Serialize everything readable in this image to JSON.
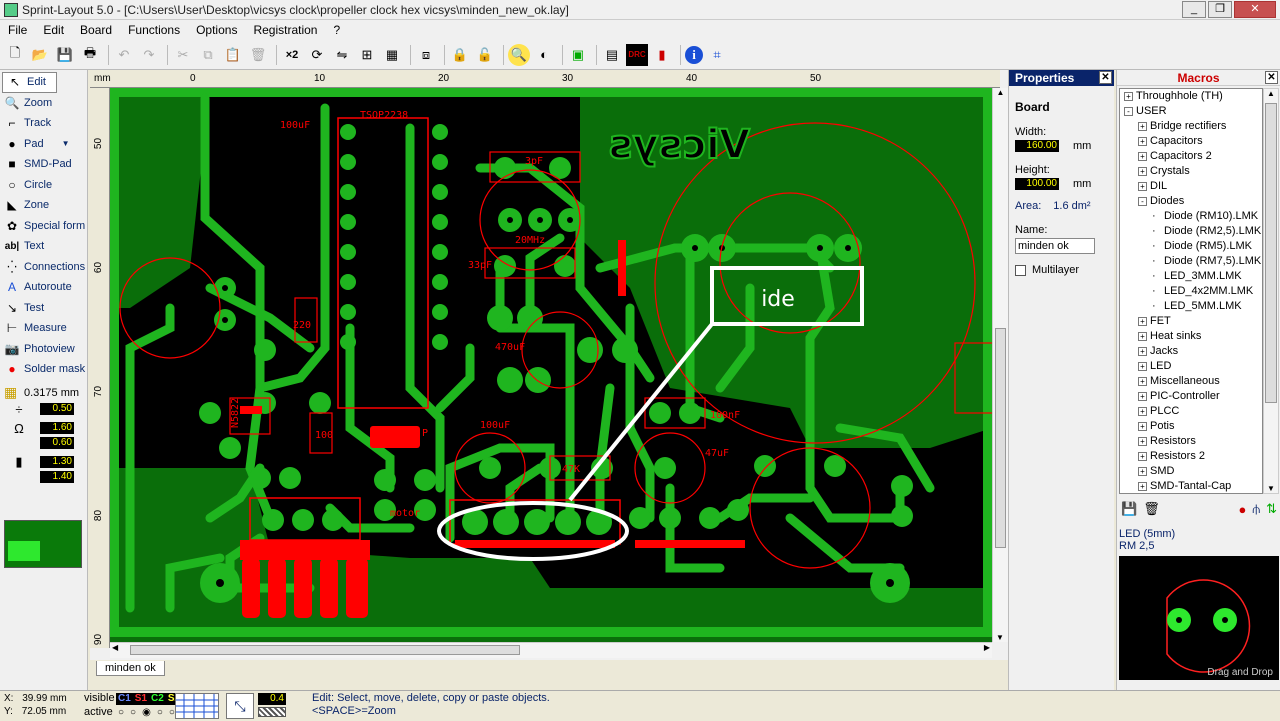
{
  "window": {
    "title": "Sprint-Layout 5.0 - [C:\\Users\\User\\Desktop\\vicsys clock\\propeller clock hex vicsys\\minden_new_ok.lay]",
    "min_icon": "minimize-icon",
    "max_icon": "maximize-icon",
    "close_icon": "close-icon"
  },
  "menu": [
    "File",
    "Edit",
    "Board",
    "Functions",
    "Options",
    "Registration",
    "?"
  ],
  "tools": [
    {
      "label": "Edit",
      "icon": "arrow-cursor-icon"
    },
    {
      "label": "Zoom",
      "icon": "magnifier-icon"
    },
    {
      "label": "Track",
      "icon": "track-icon"
    },
    {
      "label": "Pad",
      "icon": "pad-icon"
    },
    {
      "label": "SMD-Pad",
      "icon": "smd-pad-icon"
    },
    {
      "label": "Circle",
      "icon": "circle-icon"
    },
    {
      "label": "Zone",
      "icon": "zone-icon"
    },
    {
      "label": "Special form",
      "icon": "special-form-icon"
    },
    {
      "label": "Text",
      "icon": "text-icon"
    },
    {
      "label": "Connections",
      "icon": "connections-icon"
    },
    {
      "label": "Autoroute",
      "icon": "autoroute-icon"
    },
    {
      "label": "Test",
      "icon": "test-icon"
    },
    {
      "label": "Measure",
      "icon": "measure-icon"
    },
    {
      "label": "Photoview",
      "icon": "camera-icon"
    },
    {
      "label": "Solder mask",
      "icon": "solder-mask-icon"
    }
  ],
  "grid": {
    "value": "0.3175 mm"
  },
  "settings": {
    "track_width": "0.50",
    "pad_outer": "1.60",
    "pad_inner": "0.60",
    "smd_w": "1.30",
    "smd_h": "1.40"
  },
  "ruler": {
    "unit": "mm",
    "top_labels": [
      "0",
      "10",
      "20",
      "30",
      "40",
      "50"
    ],
    "left_labels": [
      "50",
      "60",
      "70",
      "80",
      "90"
    ]
  },
  "board": {
    "brand_text": "Vicsys",
    "annotation_text": "ide",
    "labels": [
      "100uF",
      "TSOP2238",
      "3pF",
      "20MHz",
      "33pF",
      "220",
      "100",
      "N5822",
      "470uF",
      "100uF",
      "47K",
      "100nF",
      "47uF",
      "motor",
      "P"
    ]
  },
  "tab": {
    "label": "minden ok"
  },
  "properties": {
    "title": "Properties",
    "section": "Board",
    "width_label": "Width:",
    "width_value": "160.00",
    "height_label": "Height:",
    "height_value": "100.00",
    "unit": "mm",
    "area_label": "Area:",
    "area_value": "1.6 dm²",
    "name_label": "Name:",
    "name_value": "minden ok",
    "multilayer_label": "Multilayer"
  },
  "macros": {
    "title": "Macros",
    "tree": [
      {
        "label": "Throughhole (TH)",
        "level": 0,
        "pm": "+"
      },
      {
        "label": "USER",
        "level": 0,
        "pm": "-"
      },
      {
        "label": "Bridge rectifiers",
        "level": 1,
        "pm": "+"
      },
      {
        "label": "Capacitors",
        "level": 1,
        "pm": "+"
      },
      {
        "label": "Capacitors 2",
        "level": 1,
        "pm": "+"
      },
      {
        "label": "Crystals",
        "level": 1,
        "pm": "+"
      },
      {
        "label": "DIL",
        "level": 1,
        "pm": "+"
      },
      {
        "label": "Diodes",
        "level": 1,
        "pm": "-"
      },
      {
        "label": "Diode (RM10).LMK",
        "level": 2,
        "pm": ""
      },
      {
        "label": "Diode (RM2,5).LMK",
        "level": 2,
        "pm": ""
      },
      {
        "label": "Diode (RM5).LMK",
        "level": 2,
        "pm": ""
      },
      {
        "label": "Diode (RM7,5).LMK",
        "level": 2,
        "pm": ""
      },
      {
        "label": "LED_3MM.LMK",
        "level": 2,
        "pm": ""
      },
      {
        "label": "LED_4x2MM.LMK",
        "level": 2,
        "pm": ""
      },
      {
        "label": "LED_5MM.LMK",
        "level": 2,
        "pm": ""
      },
      {
        "label": "FET",
        "level": 1,
        "pm": "+"
      },
      {
        "label": "Heat sinks",
        "level": 1,
        "pm": "+"
      },
      {
        "label": "Jacks",
        "level": 1,
        "pm": "+"
      },
      {
        "label": "LED",
        "level": 1,
        "pm": "+"
      },
      {
        "label": "Miscellaneous",
        "level": 1,
        "pm": "+"
      },
      {
        "label": "PIC-Controller",
        "level": 1,
        "pm": "+"
      },
      {
        "label": "PLCC",
        "level": 1,
        "pm": "+"
      },
      {
        "label": "Potis",
        "level": 1,
        "pm": "+"
      },
      {
        "label": "Resistors",
        "level": 1,
        "pm": "+"
      },
      {
        "label": "Resistors 2",
        "level": 1,
        "pm": "+"
      },
      {
        "label": "SMD",
        "level": 1,
        "pm": "+"
      },
      {
        "label": "SMD-Tantal-Cap",
        "level": 1,
        "pm": "+"
      }
    ],
    "preview_title": "LED (5mm)",
    "preview_sub": "RM 2,5",
    "drag_hint": "Drag and Drop"
  },
  "status": {
    "x_label": "X:",
    "x_value": "39.99 mm",
    "y_label": "Y:",
    "y_value": "72.05 mm",
    "visible_label": "visible",
    "active_label": "active",
    "layers": [
      {
        "name": "C1",
        "color": "#3a6aff"
      },
      {
        "name": "S1",
        "color": "#ff3030"
      },
      {
        "name": "C2",
        "color": "#30ff30"
      },
      {
        "name": "S2",
        "color": "#ffff30"
      },
      {
        "name": "O",
        "color": "#ffffff"
      }
    ],
    "small_value": "0.4",
    "hint_line1": "Edit: Select, move, delete, copy or paste objects.",
    "hint_line2": "<SPACE>=Zoom"
  },
  "colors": {
    "copper": "#1fb51f",
    "ground": "#0a6e0a",
    "silk": "#ff0000",
    "board_bg": "#000000",
    "pad_fill": "#2ee82e"
  }
}
